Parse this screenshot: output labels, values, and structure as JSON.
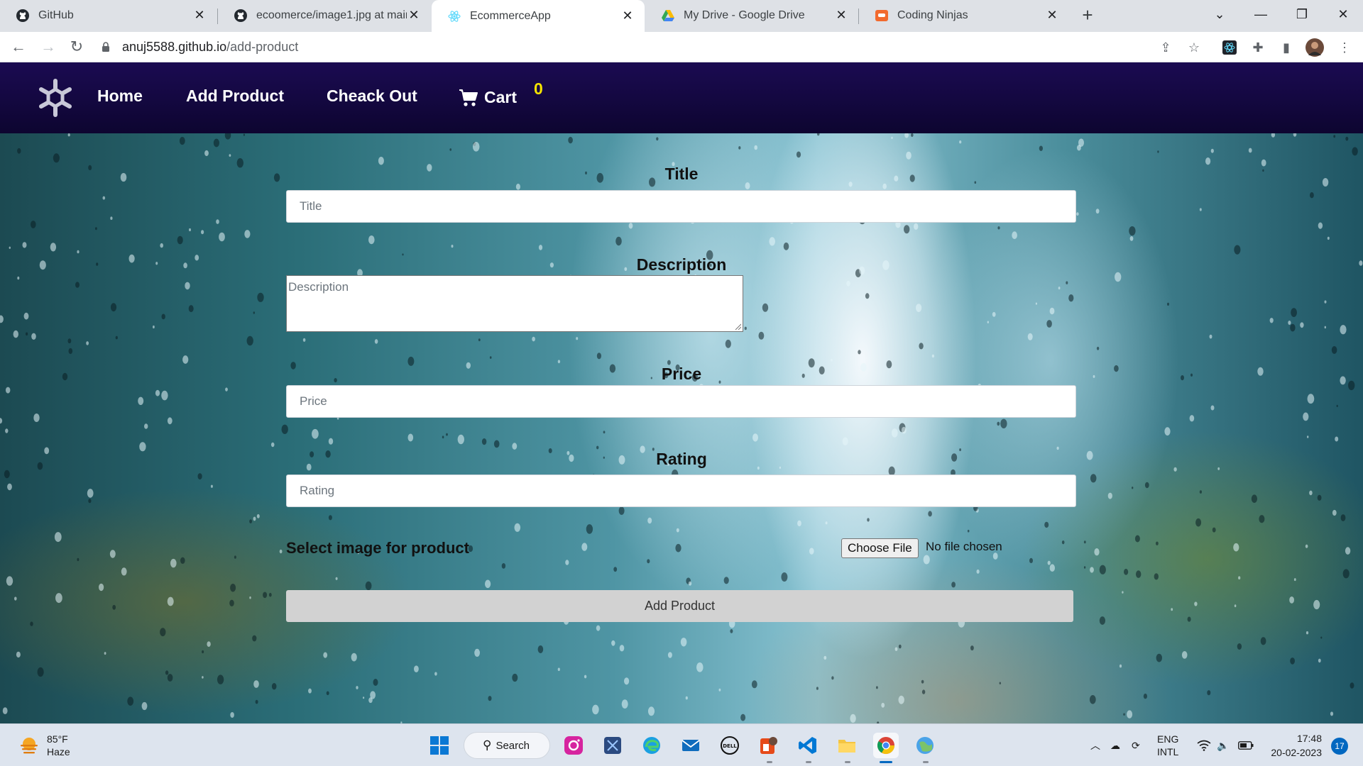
{
  "browser": {
    "tabs": [
      {
        "title": "GitHub",
        "icon": "github-icon"
      },
      {
        "title": "ecoomerce/image1.jpg at main ·",
        "icon": "github-icon"
      },
      {
        "title": "EcommerceApp",
        "icon": "react-icon"
      },
      {
        "title": "My Drive - Google Drive",
        "icon": "google-drive-icon"
      },
      {
        "title": "Coding Ninjas",
        "icon": "coding-ninjas-icon"
      }
    ],
    "active_tab_index": 2,
    "url_host": "anuj5588.github.io",
    "url_path": "/add-product"
  },
  "navbar": {
    "links": [
      "Home",
      "Add Product",
      "Cheack Out"
    ],
    "cart_label": "Cart",
    "cart_count": "0",
    "bg_color": "#12083d"
  },
  "form": {
    "title_label": "Title",
    "title_placeholder": "Title",
    "description_label": "Description",
    "description_placeholder": "Description",
    "price_label": "Price",
    "price_placeholder": "Price",
    "rating_label": "Rating",
    "rating_placeholder": "Rating",
    "image_label": "Select image for product",
    "file_button": "Choose File",
    "file_status": "No file chosen",
    "submit_label": "Add Product"
  },
  "taskbar": {
    "weather_temp": "85°F",
    "weather_desc": "Haze",
    "search_label": "Search",
    "language": "ENG",
    "layout": "INTL",
    "time": "17:48",
    "date": "20-02-2023",
    "notification_count": "17"
  }
}
